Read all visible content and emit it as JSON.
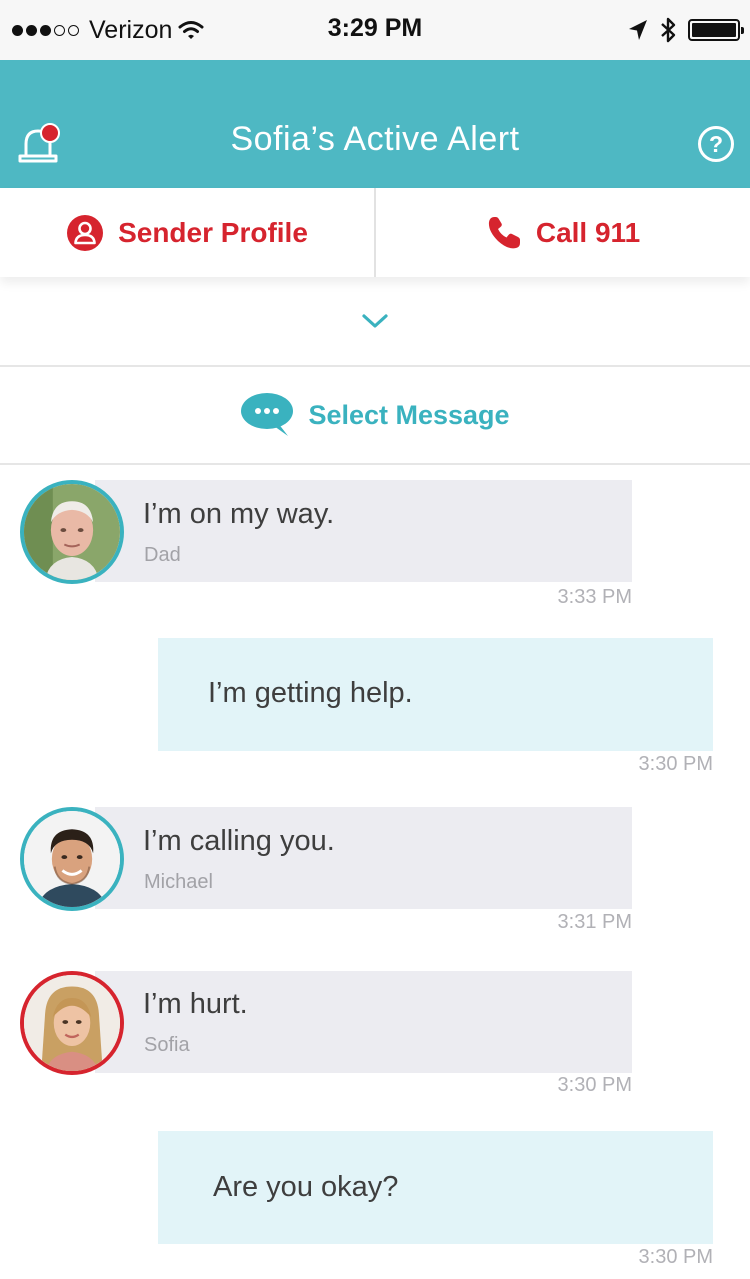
{
  "status_bar": {
    "carrier": "Verizon",
    "time": "3:29 PM"
  },
  "header": {
    "title": "Sofia’s Active Alert"
  },
  "actions": {
    "sender_profile": "Sender Profile",
    "call": "Call 911"
  },
  "select_message": {
    "label": "Select Message"
  },
  "messages": [
    {
      "text": "I’m on my way.",
      "sender": "Dad",
      "time": "3:33 PM"
    },
    {
      "text": "I’m getting help.",
      "time": "3:30 PM"
    },
    {
      "text": "I’m calling you.",
      "sender": "Michael",
      "time": "3:31 PM"
    },
    {
      "text": "I’m hurt.",
      "sender": "Sofia",
      "time": "3:30 PM"
    },
    {
      "text": "Are you okay?",
      "time": "3:30 PM"
    }
  ],
  "colors": {
    "header_teal": "#4eb8c3",
    "accent_red": "#d6242e",
    "accent_teal": "#3ab2bf",
    "received_bubble": "#ececf1",
    "sent_bubble": "#e2f4f8"
  },
  "icons": [
    "signal-dots-icon",
    "wifi-icon",
    "location-arrow-icon",
    "bluetooth-icon",
    "battery-icon",
    "alert-bell-icon",
    "help-icon",
    "profile-icon",
    "phone-icon",
    "chevron-down-icon",
    "chat-bubble-icon"
  ]
}
